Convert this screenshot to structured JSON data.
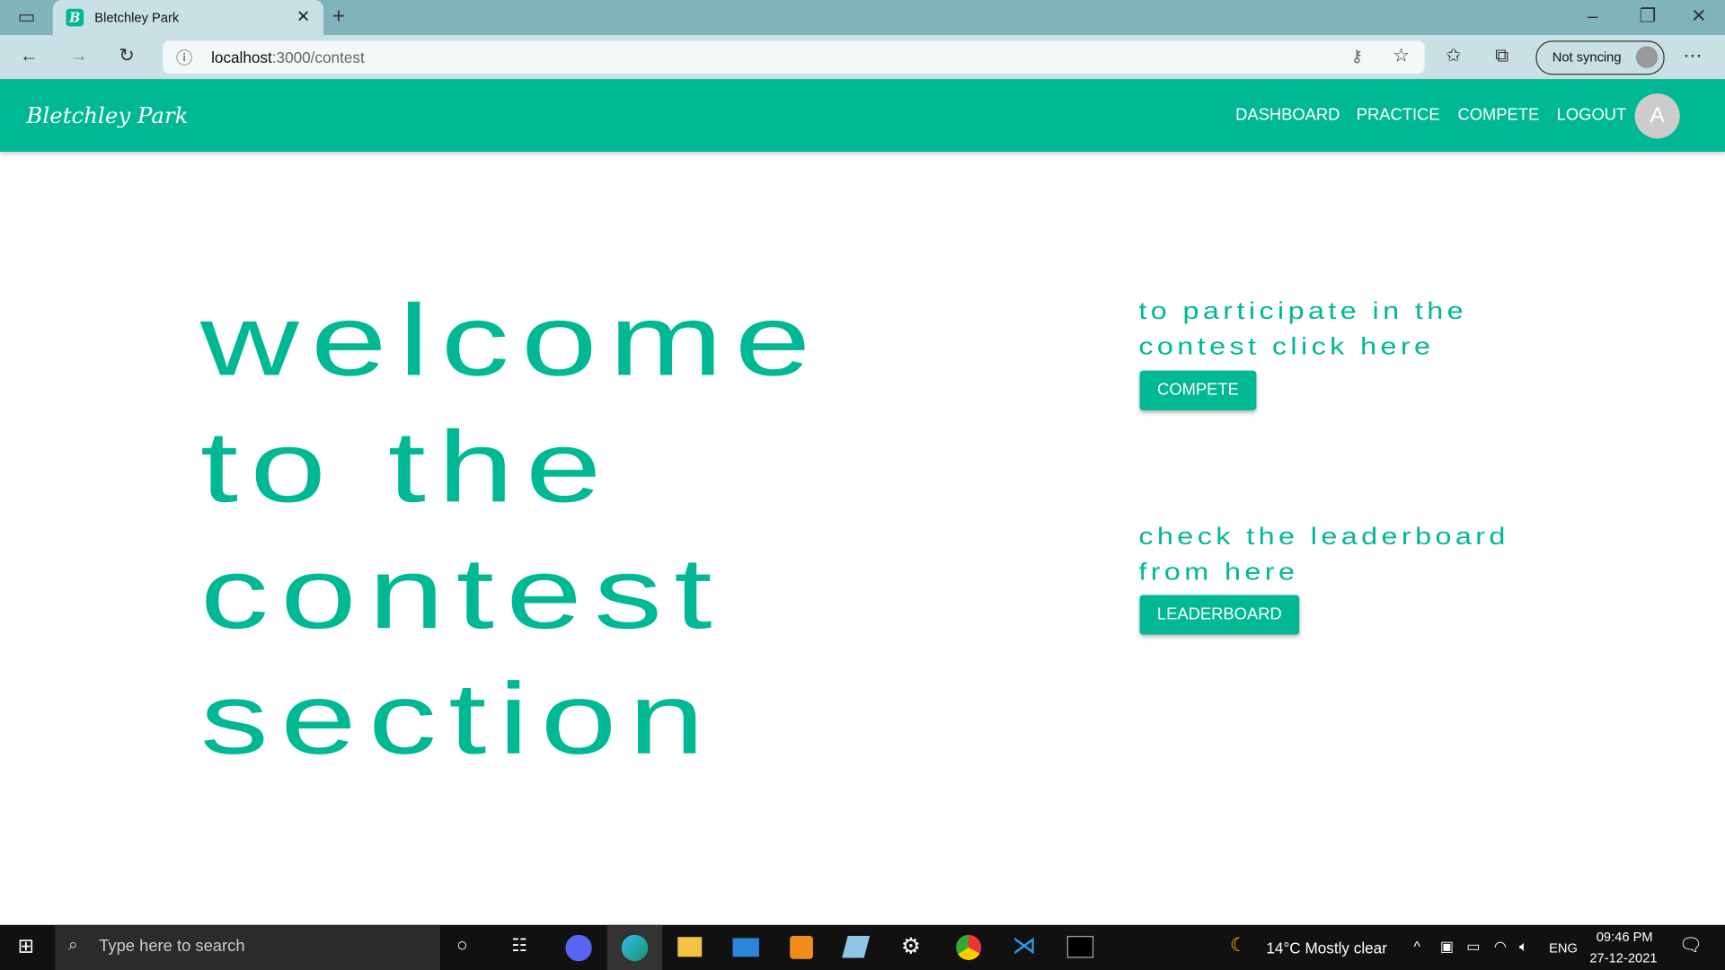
{
  "browser": {
    "tab_title": "Bletchley Park",
    "tab_favicon_letter": "B",
    "url_host": "localhost",
    "url_path": ":3000/contest",
    "profile_label": "Not syncing"
  },
  "navbar": {
    "brand": "Bletchley Park",
    "links": [
      "DASHBOARD",
      "PRACTICE",
      "COMPETE",
      "LOGOUT"
    ],
    "avatar_letter": "A"
  },
  "main": {
    "heading_lines": [
      "Welcome",
      "to the",
      "contest",
      "section"
    ],
    "compete_text_lines": [
      "To participate in the",
      "contest click here"
    ],
    "compete_button": "COMPETE",
    "leaderboard_text_lines": [
      "Check the leaderboard",
      "from here"
    ],
    "leaderboard_button": "LEADERBOARD"
  },
  "taskbar": {
    "search_placeholder": "Type here to search",
    "weather": "14°C  Mostly clear",
    "language": "ENG",
    "time": "09:46 PM",
    "date": "27-12-2021"
  },
  "colors": {
    "accent": "#00b894"
  }
}
